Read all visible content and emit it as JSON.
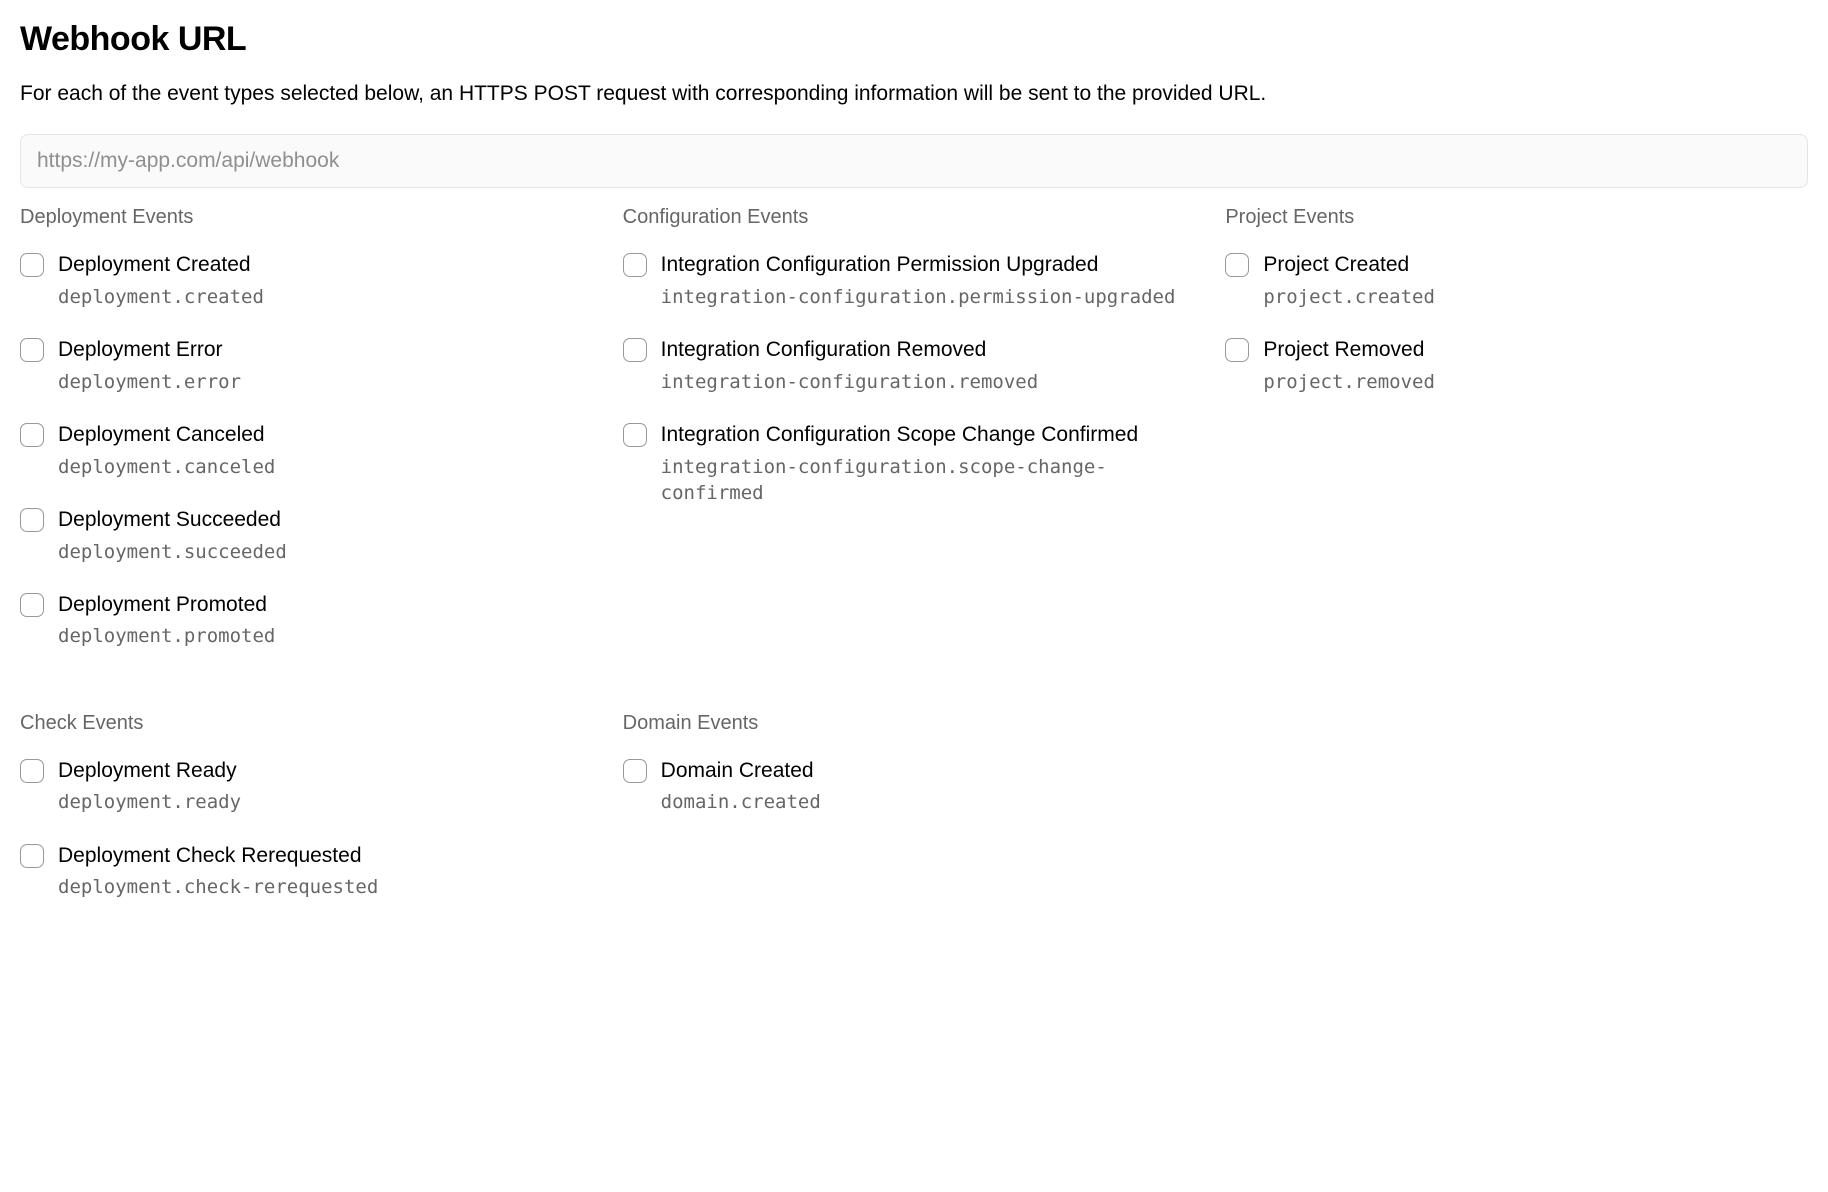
{
  "header": {
    "title": "Webhook URL",
    "description": "For each of the event types selected below, an HTTPS POST request with corresponding information will be sent to the provided URL."
  },
  "url_input": {
    "placeholder": "https://my-app.com/api/webhook",
    "value": ""
  },
  "groups": [
    {
      "name": "deployment-events",
      "title": "Deployment Events",
      "events": [
        {
          "label": "Deployment Created",
          "code": "deployment.created"
        },
        {
          "label": "Deployment Error",
          "code": "deployment.error"
        },
        {
          "label": "Deployment Canceled",
          "code": "deployment.canceled"
        },
        {
          "label": "Deployment Succeeded",
          "code": "deployment.succeeded"
        },
        {
          "label": "Deployment Promoted",
          "code": "deployment.promoted"
        }
      ]
    },
    {
      "name": "configuration-events",
      "title": "Configuration Events",
      "events": [
        {
          "label": "Integration Configuration Permission Upgraded",
          "code": "integration-configuration.permission-upgraded"
        },
        {
          "label": "Integration Configuration Removed",
          "code": "integration-configuration.removed"
        },
        {
          "label": "Integration Configuration Scope Change Confirmed",
          "code": "integration-configuration.scope-change-confirmed"
        }
      ]
    },
    {
      "name": "project-events",
      "title": "Project Events",
      "events": [
        {
          "label": "Project Created",
          "code": "project.created"
        },
        {
          "label": "Project Removed",
          "code": "project.removed"
        }
      ]
    },
    {
      "name": "check-events",
      "title": "Check Events",
      "events": [
        {
          "label": "Deployment Ready",
          "code": "deployment.ready"
        },
        {
          "label": "Deployment Check Rerequested",
          "code": "deployment.check-rerequested"
        }
      ]
    },
    {
      "name": "domain-events",
      "title": "Domain Events",
      "events": [
        {
          "label": "Domain Created",
          "code": "domain.created"
        }
      ]
    }
  ]
}
